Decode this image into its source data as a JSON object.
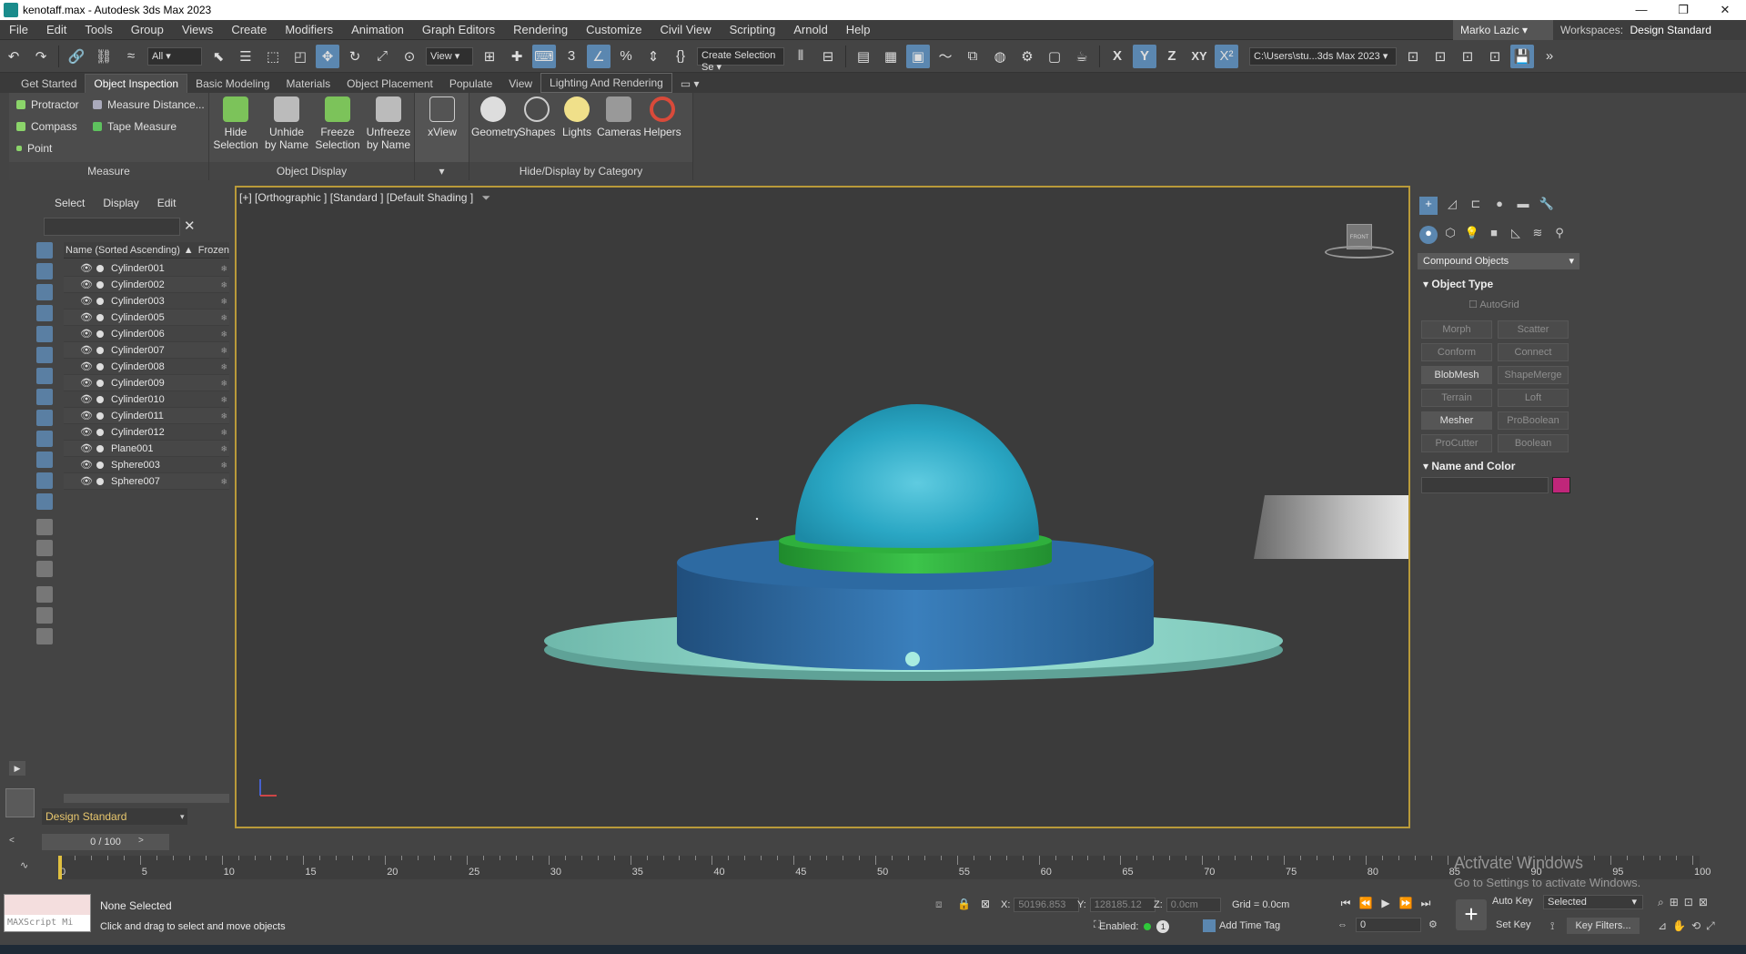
{
  "window": {
    "title": "kenotaff.max - Autodesk 3ds Max 2023",
    "controls": [
      "—",
      "❐",
      "✕"
    ]
  },
  "menu": [
    "File",
    "Edit",
    "Tools",
    "Group",
    "Views",
    "Create",
    "Modifiers",
    "Animation",
    "Graph Editors",
    "Rendering",
    "Customize",
    "Civil View",
    "Scripting",
    "Arnold",
    "Help"
  ],
  "user": {
    "name": "Marko Lazic"
  },
  "workspaces": {
    "label": "Workspaces:",
    "value": "Design Standard"
  },
  "toolbar": {
    "filter": "All",
    "refcoord": "View",
    "selection_set": "Create Selection Se",
    "axes": [
      "X",
      "Y",
      "Z",
      "XY"
    ],
    "path": "C:\\Users\\stu...3ds Max 2023"
  },
  "ribbon": {
    "tabs": [
      "Get Started",
      "Object Inspection",
      "Basic Modeling",
      "Materials",
      "Object Placement",
      "Populate",
      "View",
      "Lighting And Rendering"
    ],
    "active_tab": "Object Inspection",
    "measure": {
      "label": "Measure",
      "items": [
        "Protractor",
        "Measure Distance...",
        "Compass",
        "Tape Measure",
        "Point"
      ]
    },
    "object_display": {
      "label": "Object Display",
      "buttons": [
        "Hide Selection",
        "Unhide by Name",
        "Freeze Selection",
        "Unfreeze by Name"
      ]
    },
    "xview": {
      "label": "xView"
    },
    "hide_display": {
      "label": "Hide/Display by Category",
      "buttons": [
        "Geometry",
        "Shapes",
        "Lights",
        "Cameras",
        "Helpers"
      ]
    }
  },
  "scene_explorer": {
    "tabs": [
      "Select",
      "Display",
      "Edit"
    ],
    "columns": {
      "name": "Name (Sorted Ascending)",
      "frozen": "Frozen"
    },
    "items": [
      "Cylinder001",
      "Cylinder002",
      "Cylinder003",
      "Cylinder005",
      "Cylinder006",
      "Cylinder007",
      "Cylinder008",
      "Cylinder009",
      "Cylinder010",
      "Cylinder011",
      "Cylinder012",
      "Plane001",
      "Sphere003",
      "Sphere007"
    ],
    "workspace": "Design Standard"
  },
  "viewport": {
    "label": "[+] [Orthographic ] [Standard ] [Default Shading ]",
    "viewcube_label": "FRONT"
  },
  "command_panel": {
    "category": "Compound Objects",
    "object_type": {
      "title": "Object Type",
      "autogrid": "AutoGrid",
      "buttons": [
        {
          "label": "Morph",
          "enabled": false
        },
        {
          "label": "Scatter",
          "enabled": false
        },
        {
          "label": "Conform",
          "enabled": false
        },
        {
          "label": "Connect",
          "enabled": false
        },
        {
          "label": "BlobMesh",
          "enabled": true
        },
        {
          "label": "ShapeMerge",
          "enabled": false
        },
        {
          "label": "Terrain",
          "enabled": false
        },
        {
          "label": "Loft",
          "enabled": false
        },
        {
          "label": "Mesher",
          "enabled": true
        },
        {
          "label": "ProBoolean",
          "enabled": false
        },
        {
          "label": "ProCutter",
          "enabled": false
        },
        {
          "label": "Boolean",
          "enabled": false
        }
      ]
    },
    "name_and_color": {
      "title": "Name and Color",
      "color": "#c0267a"
    }
  },
  "timeline": {
    "slider": "0 / 100",
    "labels": [
      "0",
      "5",
      "10",
      "15",
      "20",
      "25",
      "30",
      "35",
      "40",
      "45",
      "50",
      "55",
      "60",
      "65",
      "70",
      "75",
      "80",
      "85",
      "90",
      "95",
      "100"
    ]
  },
  "status": {
    "maxscript": "MAXScript Mi",
    "selection": "None Selected",
    "prompt": "Click and drag to select and move objects",
    "x_label": "X:",
    "x_value": "50196.853",
    "y_label": "Y:",
    "y_value": "128185.12",
    "z_label": "Z:",
    "z_value": "0.0cm",
    "grid": "Grid = 0.0cm",
    "enabled": "Enabled:",
    "add_time_tag": "Add Time Tag",
    "frame": "0",
    "auto_key": "Auto Key",
    "selected": "Selected",
    "set_key": "Set Key",
    "key_filters": "Key Filters..."
  },
  "watermark": {
    "line1": "Activate Windows",
    "line2": "Go to Settings to activate Windows."
  },
  "colors": {
    "sphere": "#2aa7c4",
    "ring": "#2aa53a",
    "cylinder": "#2f6fa8",
    "plate": "#8fd8cc",
    "accent": "#5b87b0"
  }
}
